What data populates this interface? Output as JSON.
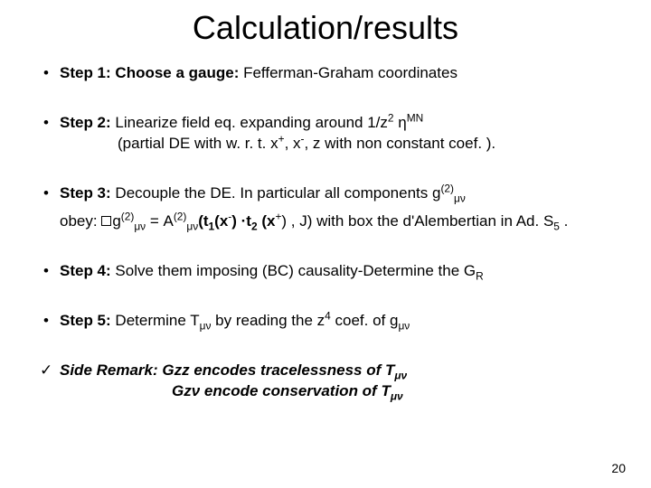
{
  "title": "Calculation/results",
  "steps": {
    "s1": {
      "label": "Step 1:",
      "text": " Choose a gauge:",
      "tail": " Fefferman-Graham coordinates"
    },
    "s2": {
      "label": "Step 2:",
      "text": " Linearize field eq. expanding around 1/z",
      "exp": "2",
      "eta_sup": "MN",
      "line2_a": "(partial DE with w. r. t. x",
      "sup_plus": "+",
      "comma_x": ", x",
      "sup_minus": "-",
      "line2_b": ", z with non constant coef. )."
    },
    "s3": {
      "label": "Step 3:",
      "text": " Decouple the DE. In particular all components g",
      "sup2": "(2)",
      "sub_mn": "μν",
      "obey": "obey: ",
      "g": "g",
      "eq": " = A",
      "t1": "t",
      "one": "1",
      "xminus": "(x",
      "dot": ") ·",
      "t2": "t",
      "two": "2",
      "xplus": " (x",
      "tail": ") , J) with box the d'Alembertian in Ad. S",
      "five": "5",
      "period": " .",
      "open_paren": "("
    },
    "s4": {
      "label": "Step 4:",
      "text": " Solve them imposing (BC) causality-Determine the G",
      "R": "R"
    },
    "s5": {
      "label": "Step 5:",
      "text": " Determine T",
      "mn": "μν",
      "mid": " by reading the z",
      "four": "4",
      "coef": " coef. of g"
    },
    "remark": {
      "label": "Side Remark:",
      "l1a": "  Gzz  encodes tracelessness of  T",
      "mn": "μν",
      "l2": "Gzν encode conservation of T"
    }
  },
  "pagenum": "20"
}
